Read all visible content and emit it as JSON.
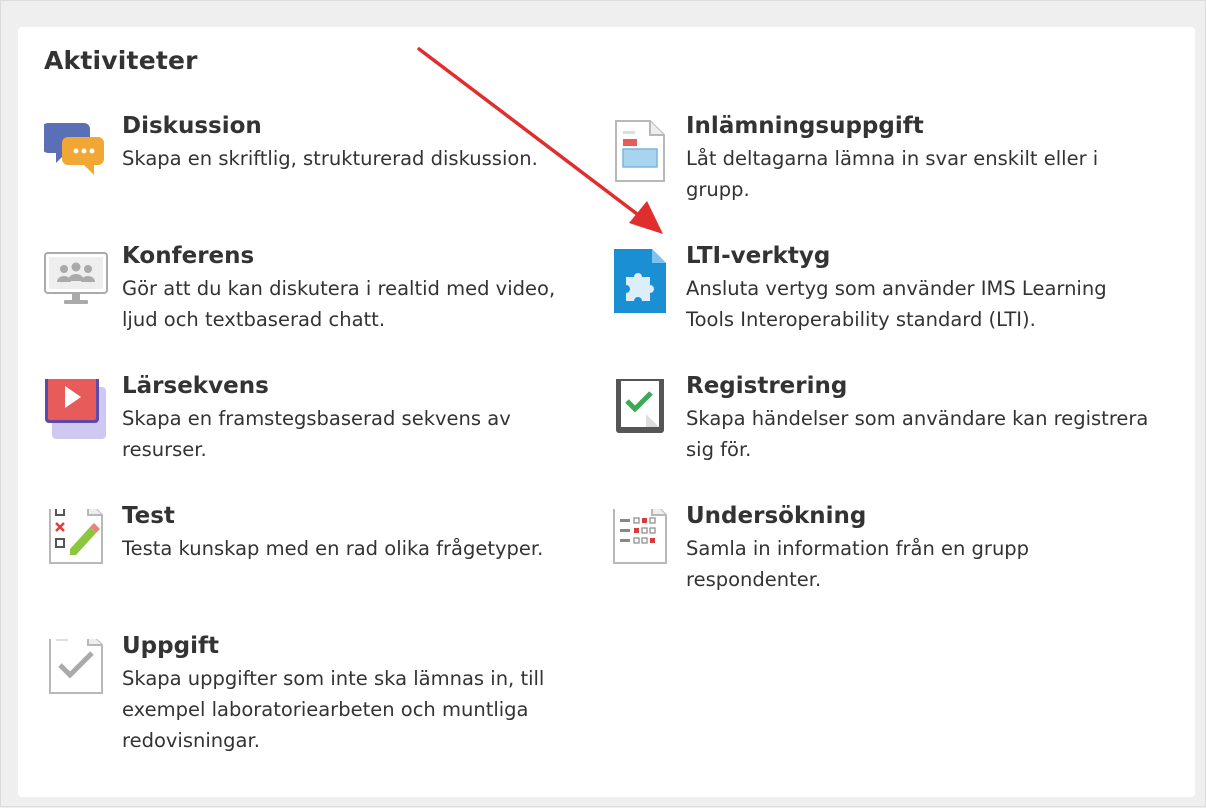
{
  "heading": "Aktiviteter",
  "activities": [
    {
      "title": "Diskussion",
      "desc": "Skapa en skriftlig, strukturerad diskussion.",
      "icon": "discussion-icon"
    },
    {
      "title": "Inlämningsuppgift",
      "desc": "Låt deltagarna lämna in svar enskilt eller i grupp.",
      "icon": "assignment-submission-icon"
    },
    {
      "title": "Konferens",
      "desc": "Gör att du kan diskutera i realtid med video, ljud och textbaserad chatt.",
      "icon": "conference-icon"
    },
    {
      "title": "LTI-verktyg",
      "desc": "Ansluta vertyg som använder IMS Learning Tools Interoperability standard (LTI).",
      "icon": "lti-puzzle-icon"
    },
    {
      "title": "Lärsekvens",
      "desc": "Skapa en framstegsbaserad sekvens av resurser.",
      "icon": "play-sequence-icon"
    },
    {
      "title": "Registrering",
      "desc": "Skapa händelser som användare kan registrera sig för.",
      "icon": "registration-clipboard-icon"
    },
    {
      "title": "Test",
      "desc": "Testa kunskap med en rad olika frågetyper.",
      "icon": "test-checklist-icon"
    },
    {
      "title": "Undersökning",
      "desc": "Samla in information från en grupp respondenter.",
      "icon": "survey-icon"
    },
    {
      "title": "Uppgift",
      "desc": "Skapa uppgifter som inte ska lämnas in, till exempel laboratoriearbeten och muntliga redovisningar.",
      "icon": "task-check-icon"
    }
  ],
  "colors": {
    "annotation_arrow": "#e02d2d",
    "lti_blue": "#1a8fd4",
    "sequence_red": "#e85b5b",
    "sequence_purple": "#5b4aa8",
    "registration_green": "#3aaa55",
    "survey_red": "#d93b3b"
  }
}
